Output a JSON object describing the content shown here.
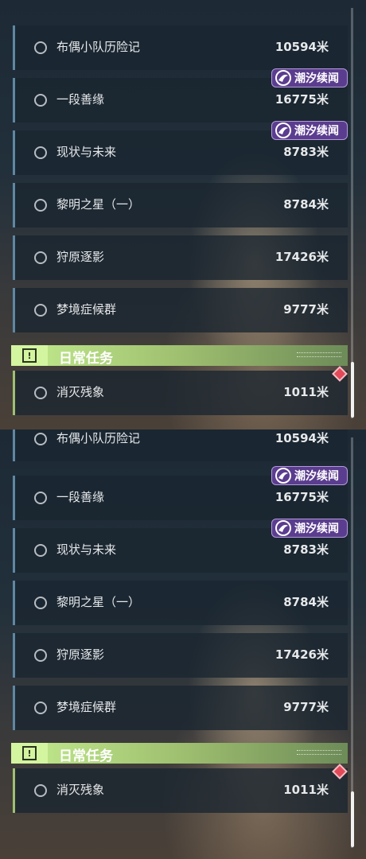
{
  "panels": [
    {
      "quests": [
        {
          "name": "布偶小队历险记",
          "distance": "10594米",
          "badge": null
        },
        {
          "name": "一段善缘",
          "distance": "16775米",
          "badge": "潮汐续闻"
        },
        {
          "name": "现状与未来",
          "distance": "8783米",
          "badge": "潮汐续闻"
        },
        {
          "name": "黎明之星（一）",
          "distance": "8784米",
          "badge": null
        },
        {
          "name": "狩原逐影",
          "distance": "17426米",
          "badge": null
        },
        {
          "name": "梦境症候群",
          "distance": "9777米",
          "badge": null
        }
      ],
      "section_title": "日常任务",
      "daily": {
        "name": "消灭残象",
        "distance": "1011米"
      }
    },
    {
      "quests": [
        {
          "name": "布偶小队历险记",
          "distance": "10594米",
          "badge": null
        },
        {
          "name": "一段善缘",
          "distance": "16775米",
          "badge": "潮汐续闻"
        },
        {
          "name": "现状与未来",
          "distance": "8783米",
          "badge": "潮汐续闻"
        },
        {
          "name": "黎明之星（一）",
          "distance": "8784米",
          "badge": null
        },
        {
          "name": "狩原逐影",
          "distance": "17426米",
          "badge": null
        },
        {
          "name": "梦境症候群",
          "distance": "9777米",
          "badge": null
        }
      ],
      "section_title": "日常任务",
      "daily": {
        "name": "消灭残象",
        "distance": "1011米"
      }
    }
  ],
  "colors": {
    "quest_accent": "#5e87a2",
    "daily_accent": "#9fc070",
    "badge_bg": "#5b3d8f",
    "marker": "#e24a59"
  }
}
